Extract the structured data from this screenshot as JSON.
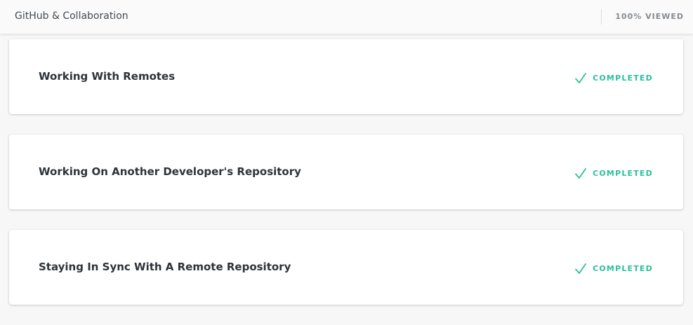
{
  "header": {
    "title": "GitHub & Collaboration",
    "progress_text": "100% VIEWED"
  },
  "lessons": [
    {
      "title": "Working With Remotes",
      "status": "COMPLETED",
      "status_icon": "checkmark-icon"
    },
    {
      "title": "Working On Another Developer's Repository",
      "status": "COMPLETED",
      "status_icon": "checkmark-icon"
    },
    {
      "title": "Staying In Sync With A Remote Repository",
      "status": "COMPLETED",
      "status_icon": "checkmark-icon"
    }
  ],
  "colors": {
    "completed": "#2bbf9a",
    "header_bg": "#fafafa",
    "page_bg": "#f7f7f8"
  }
}
